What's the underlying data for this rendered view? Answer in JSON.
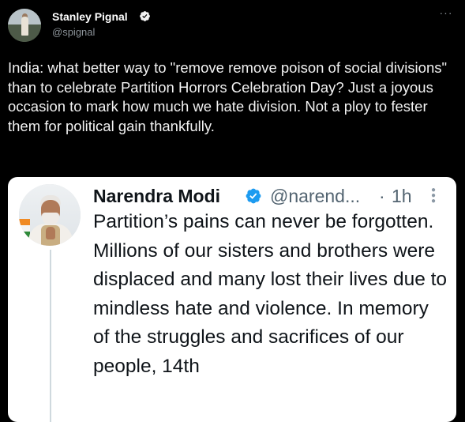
{
  "tweet": {
    "author_name": "Stanley Pignal",
    "author_handle": "@spignal",
    "text": "India: what better way to \"remove remove poison of social divisions\" than to celebrate Partition Horrors Celebration Day? Just a joyous occasion to mark how much we hate division. Not a ploy to fester them for political gain thankfully.",
    "more_icon": "ellipsis-icon",
    "verified_icon": "verified-badge-icon"
  },
  "quoted_tweet": {
    "author_name": "Narendra Modi",
    "author_handle": "@narend...",
    "separator": "·",
    "time": "1h",
    "text": "Partition’s pains can never be forgotten. Millions of our sisters and brothers were displaced and many lost their lives due to mindless hate and violence. In memory of the struggles and sacrifices of our people, 14th",
    "verified_color": "#1d9bf0"
  },
  "colors": {
    "background": "#000000",
    "card_background": "#ffffff",
    "verified": "#1d9bf0",
    "secondary_text": "#8b9298"
  }
}
